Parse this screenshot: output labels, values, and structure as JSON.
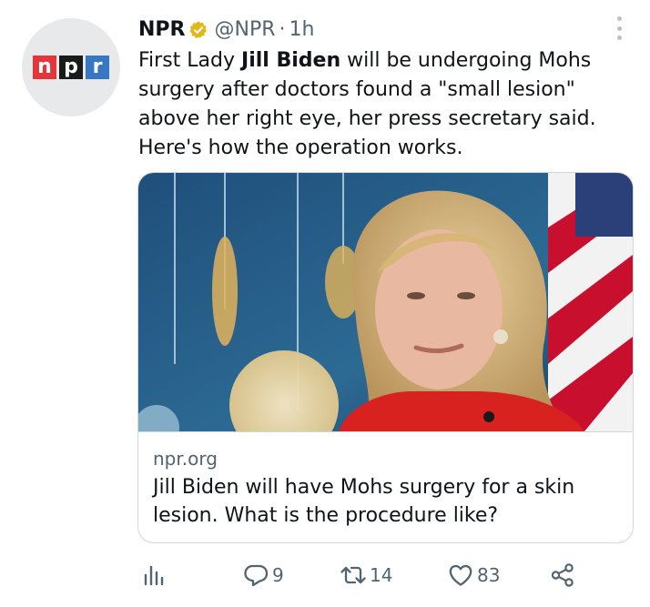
{
  "account": {
    "name": "NPR",
    "handle": "@NPR",
    "separator": "·",
    "time": "1h",
    "avatar_logo": [
      "n",
      "p",
      "r"
    ]
  },
  "tweet": {
    "text_before": "First Lady ",
    "text_bold": "Jill Biden",
    "text_after": " will be undergoing Mohs surgery after doctors found a \"small lesion\" above her right eye, her press secretary said. Here's how the operation works."
  },
  "card": {
    "domain": "npr.org",
    "title": "Jill Biden will have Mohs surgery for a skin lesion. What is the procedure like?"
  },
  "actions": {
    "replies": "9",
    "retweets": "14",
    "likes": "83"
  },
  "icons": {
    "verified": "verified-badge-icon",
    "more": "more-options-icon",
    "analytics": "analytics-icon",
    "reply": "reply-icon",
    "retweet": "retweet-icon",
    "like": "heart-icon",
    "share": "share-icon"
  },
  "colors": {
    "verified_gold": "#e2b719",
    "npr_red": "#e4353a",
    "npr_black": "#1a1a1a",
    "npr_blue": "#3777c3",
    "secondary_text": "#536471"
  }
}
